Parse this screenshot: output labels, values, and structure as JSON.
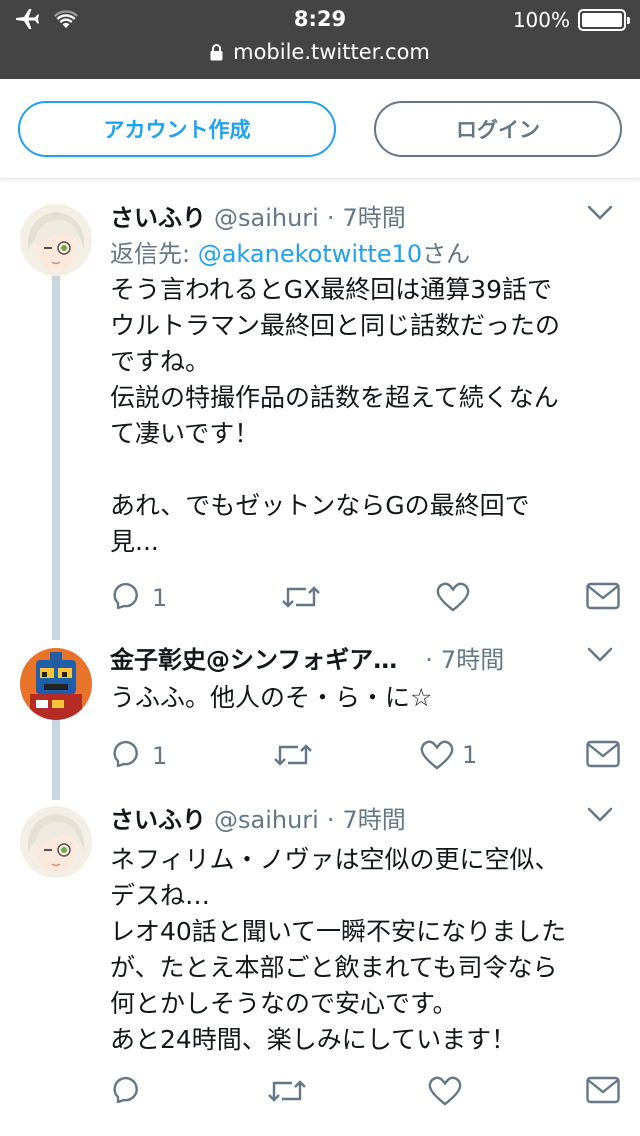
{
  "status_bar": {
    "time": "8:29",
    "battery": "100%",
    "battery_level": 1.0
  },
  "browser": {
    "url": "mobile.twitter.com"
  },
  "header": {
    "signup_label": "アカウント作成",
    "login_label": "ログイン"
  },
  "tweets": [
    {
      "name": "さいふり",
      "handle": "@saihuri",
      "dot": "·",
      "time": "7時間",
      "reply_prefix": "返信先: ",
      "reply_mention": "@akanekotwitte10",
      "reply_suffix": "さん",
      "text": "そう言われるとGX最終回は通算39話で\nウルトラマン最終回と同じ話数だったの\nですね。\n伝説の特撮作品の話数を超えて続くなん\nて凄いです！\n\nあれ、でもゼットンならGの最終回で\n見...",
      "reply_count": "1",
      "retweet_count": "",
      "like_count": ""
    },
    {
      "name": "金子彰史@シンフォギア…",
      "handle": "",
      "dot": "·",
      "time": "7時間",
      "text": "うふふ。他人のそ・ら・に☆",
      "reply_count": "1",
      "retweet_count": "",
      "like_count": "1"
    },
    {
      "name": "さいふり",
      "handle": "@saihuri",
      "dot": "·",
      "time": "7時間",
      "text": "ネフィリム・ノヴァは空似の更に空似、\nデスね…\nレオ40話と聞いて一瞬不安になりました\nが、たとえ本部ごと飲まれても司令なら\n何とかしそうなので安心です。\nあと24時間、楽しみにしています！",
      "reply_count": "",
      "retweet_count": "",
      "like_count": ""
    }
  ],
  "colors": {
    "accent": "#1da1f2",
    "secondary": "#657786",
    "thread_line": "#c9d6df",
    "status_bg": "#444444"
  }
}
